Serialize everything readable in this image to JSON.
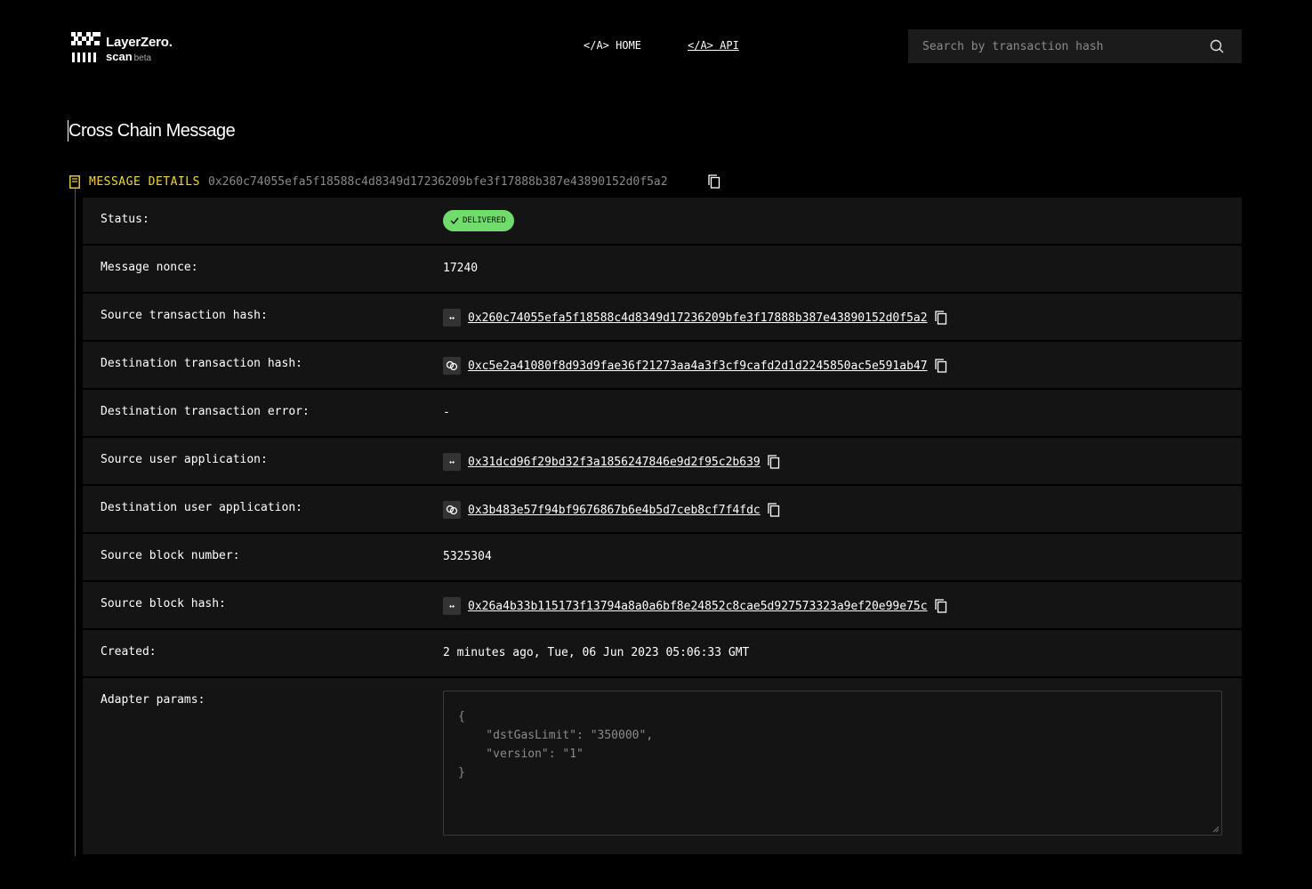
{
  "header": {
    "logo_line1": "LayerZero.",
    "logo_line2": "scan",
    "logo_beta": "beta",
    "nav": [
      {
        "label": "</A> HOME"
      },
      {
        "label": "</A> API"
      }
    ],
    "search_placeholder": "Search by transaction hash"
  },
  "page_title": "Cross Chain Message",
  "details": {
    "label": "MESSAGE DETAILS",
    "hash": "0x260c74055efa5f18588c4d8349d17236209bfe3f17888b387e43890152d0f5a2"
  },
  "rows": {
    "status": {
      "label": "Status:",
      "value": "DELIVERED"
    },
    "nonce": {
      "label": "Message nonce:",
      "value": "17240"
    },
    "src_tx": {
      "label": "Source transaction hash:",
      "value": "0x260c74055efa5f18588c4d8349d17236209bfe3f17888b387e43890152d0f5a2"
    },
    "dst_tx": {
      "label": "Destination transaction hash:",
      "value": "0xc5e2a41080f8d93d9fae36f21273aa4a3f3cf9cafd2d1d2245850ac5e591ab47"
    },
    "dst_err": {
      "label": "Destination transaction error:",
      "value": "-"
    },
    "src_ua": {
      "label": "Source user application:",
      "value": "0x31dcd96f29bd32f3a1856247846e9d2f95c2b639"
    },
    "dst_ua": {
      "label": "Destination user application:",
      "value": "0x3b483e57f94bf9676867b6e4b5d7ceb8cf7f4fdc"
    },
    "block_num": {
      "label": "Source block number:",
      "value": "5325304"
    },
    "block_hash": {
      "label": "Source block hash:",
      "value": "0x26a4b33b115173f13794a8a0a6bf8e24852c8cae5d927573323a9ef20e99e75c"
    },
    "created": {
      "label": "Created:",
      "value": "2 minutes ago, Tue, 06 Jun 2023 05:06:33 GMT"
    },
    "adapter": {
      "label": "Adapter params:",
      "value": "{\n    \"dstGasLimit\": \"350000\",\n    \"version\": \"1\"\n}"
    }
  },
  "colors": {
    "accent": "#f2d541",
    "status_green": "#6fdc6b",
    "row_bg": "#141414"
  }
}
